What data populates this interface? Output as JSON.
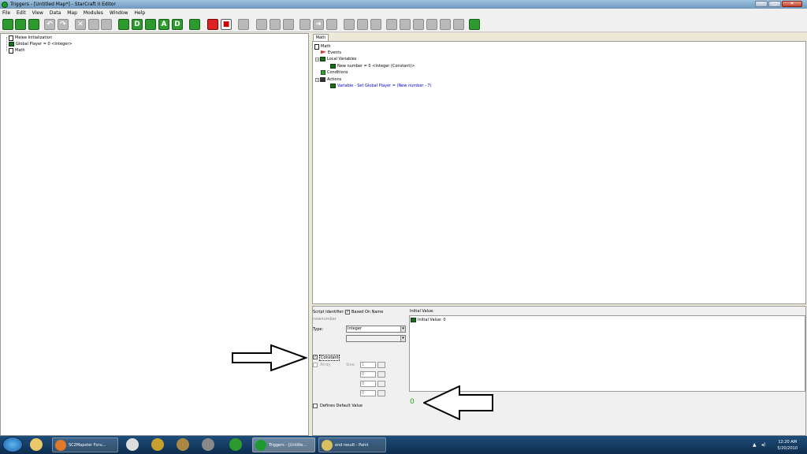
{
  "window": {
    "title": "Triggers - [Untitled Map*] - StarCraft II Editor",
    "min": "–",
    "max": "□",
    "close": "✕"
  },
  "menu": [
    "File",
    "Edit",
    "View",
    "Data",
    "Map",
    "Modules",
    "Window",
    "Help"
  ],
  "toolbar": {
    "icons": [
      "new-map",
      "open",
      "save",
      "undo",
      "redo",
      "cut",
      "copy",
      "paste",
      "terrain",
      "doodads",
      "units",
      "text",
      "data",
      "triggers",
      "cinematics",
      "record",
      "stop",
      "module",
      "blank1",
      "blank2",
      "blank3",
      "blank4",
      "arrow",
      "forward",
      "blank5",
      "blank6",
      "blank7",
      "blank8",
      "blank9",
      "blank10",
      "blank11",
      "blank12",
      "blank13",
      "blank14",
      "wizard"
    ]
  },
  "left_tree": {
    "items": [
      {
        "label": "Melee Initialization",
        "icon": "doc-icon"
      },
      {
        "label": "Global Player = 0 <Integer>",
        "icon": "var-icon"
      },
      {
        "label": "Math",
        "icon": "doc-icon"
      }
    ]
  },
  "right_tree": {
    "tab": "Math",
    "root": "Math",
    "events": "Events",
    "local_variables": "Local Variables",
    "local_var_item": "New number = 0 <Integer (Constant)>",
    "conditions": "Conditions",
    "actions": "Actions",
    "action_item": "Variable - Set Global Player = (New number - 7)"
  },
  "variable_panel": {
    "script_identifier_label": "Script Identifier:",
    "based_on_name_label": "Based On Name",
    "based_on_name_checked": true,
    "identifier_value": "newnumber",
    "type_label": "Type:",
    "type_value": "Integer",
    "constant_label": "Constant",
    "constant_checked": true,
    "array_label": "Array",
    "size_label": "Size:",
    "size_values": [
      "1",
      "0",
      "0",
      "0"
    ],
    "defines_default_label": "Defines Default Value",
    "initial_value_label": "Initial Value:",
    "initial_value_item": "Initial Value: 0",
    "result_value": "0"
  },
  "taskbar": {
    "firefox_label": "SC2Mapster Foru...",
    "triggers_label": "Triggers - [Untitle...",
    "paint_label": "end result - Paint",
    "time": "12:20 AM",
    "date": "5/20/2010"
  },
  "colors": {
    "accent_green": "#22a822",
    "taskbar": "#1e4d7a",
    "action_text": "#0000cc"
  }
}
